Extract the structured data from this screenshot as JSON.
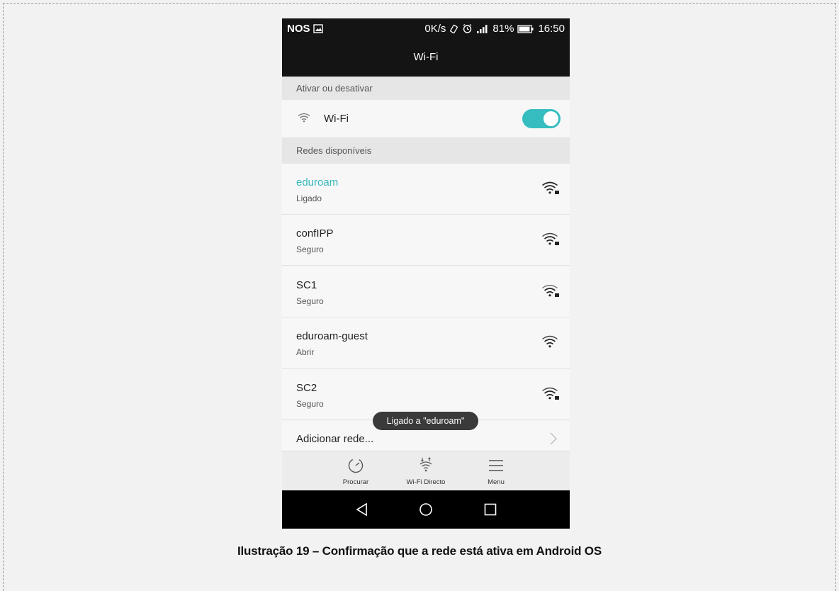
{
  "status_bar": {
    "carrier": "NOS",
    "speed": "0K/s",
    "battery": "81%",
    "time": "16:50",
    "icons": [
      "image-icon",
      "vibrate-icon",
      "alarm-icon",
      "signal-icon",
      "battery-icon"
    ]
  },
  "header": {
    "title": "Wi-Fi"
  },
  "toggle_section": {
    "header": "Ativar ou desativar",
    "label": "Wi-Fi",
    "enabled": true,
    "accent_color": "#36bdc0"
  },
  "networks_section": {
    "header": "Redes disponíveis",
    "networks": [
      {
        "name": "eduroam",
        "status": "Ligado",
        "active": true,
        "locked": true
      },
      {
        "name": "confIPP",
        "status": "Seguro",
        "active": false,
        "locked": true
      },
      {
        "name": "SC1",
        "status": "Seguro",
        "active": false,
        "locked": true
      },
      {
        "name": "eduroam-guest",
        "status": "Abrir",
        "active": false,
        "locked": false
      },
      {
        "name": "SC2",
        "status": "Seguro",
        "active": false,
        "locked": true
      }
    ]
  },
  "add_network": {
    "label": "Adicionar rede..."
  },
  "toast": {
    "text": "Ligado a \"eduroam\""
  },
  "bottom_actions": [
    {
      "label": "Procurar",
      "icon": "scan-icon"
    },
    {
      "label": "Wi-Fi Directo",
      "icon": "wifi-direct-icon"
    },
    {
      "label": "Menu",
      "icon": "menu-icon"
    }
  ],
  "nav_bar": [
    "back-icon",
    "home-icon",
    "recents-icon"
  ],
  "caption": "Ilustração 19 – Confirmação que a rede está ativa em Android OS"
}
